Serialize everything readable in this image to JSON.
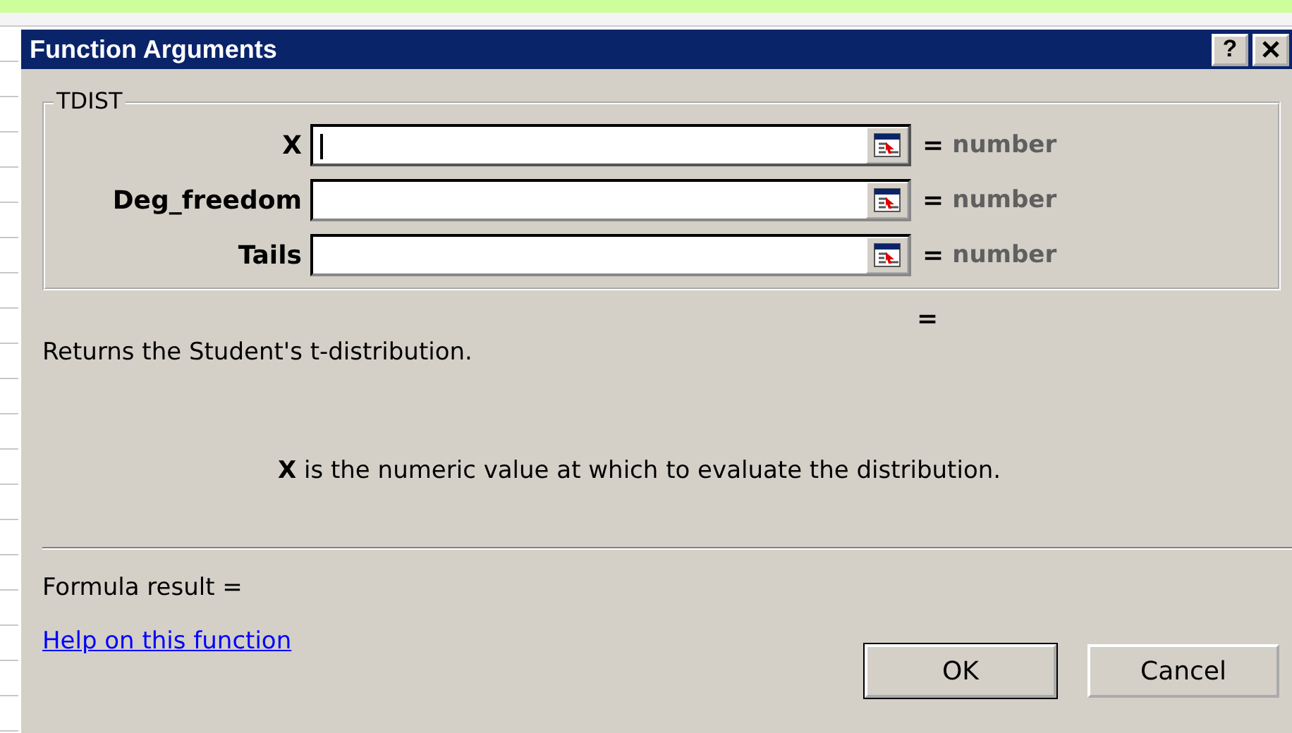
{
  "window": {
    "title": "Function Arguments",
    "help_button": "?"
  },
  "group": {
    "title": "TDIST",
    "arguments": [
      {
        "label": "X",
        "focused": true,
        "equals": "=",
        "result": "number"
      },
      {
        "label": "Deg_freedom",
        "focused": false,
        "equals": "=",
        "result": "number"
      },
      {
        "label": "Tails",
        "focused": false,
        "equals": "=",
        "result": "number"
      }
    ]
  },
  "result": "=",
  "description": "Returns the Student's t-distribution.",
  "argument_help": "**X** is the numeric value at which to evaluate the distribution.",
  "formula_result": "Formula result =",
  "help_link": "Help on this function",
  "buttons": [
    {
      "label": "OK",
      "default": true
    },
    {
      "label": "Cancel",
      "default": false
    }
  ]
}
